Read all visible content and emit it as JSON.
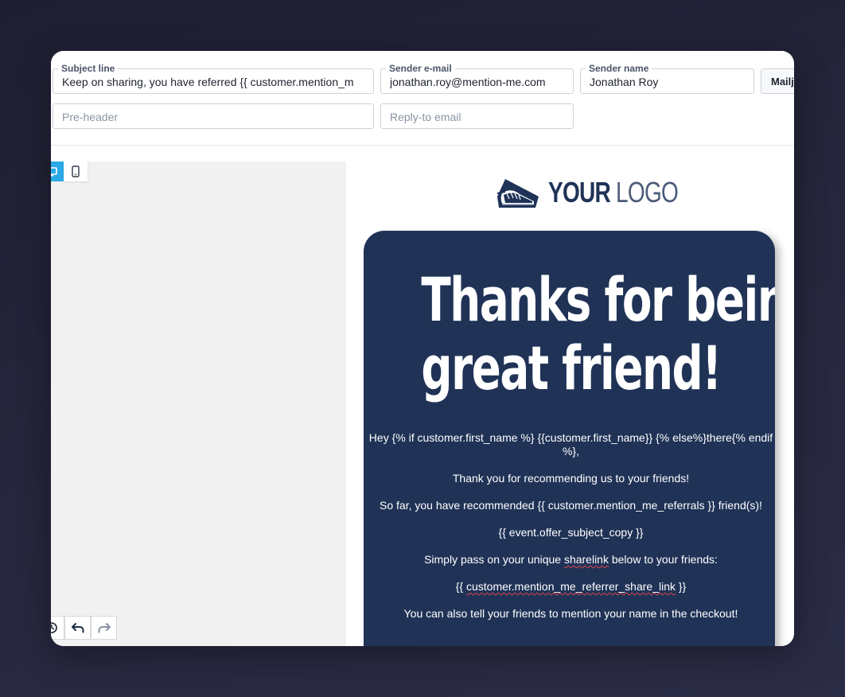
{
  "header": {
    "subject": {
      "label": "Subject line",
      "value": "Keep on sharing, you have referred {{ customer.mention_m"
    },
    "sender_email": {
      "label": "Sender e-mail",
      "value": "jonathan.roy@mention-me.com"
    },
    "sender_name": {
      "label": "Sender name",
      "value": "Jonathan Roy"
    },
    "mail_button_label": "Mailj",
    "pre_header": {
      "placeholder": "Pre-header"
    },
    "reply_to": {
      "placeholder": "Reply-to email"
    }
  },
  "editor": {
    "device_desktop_icon": "desktop-icon",
    "device_mobile_icon": "mobile-icon",
    "history_icon": "history-icon",
    "undo_icon": "undo-icon",
    "redo_icon": "redo-icon"
  },
  "email": {
    "logo": {
      "bold": "YOUR",
      "light": "LOGO",
      "icon": "sneaker-icon"
    },
    "headline_line1": "Thanks for being a",
    "headline_line2": "great friend!",
    "greeting": "Hey {% if customer.first_name %} {{customer.first_name}} {% else%}there{% endif %},",
    "thanks": "Thank you for recommending us to your friends!",
    "so_far": "So far, you have recommended {{ customer.mention_me_referrals }} friend(s)!",
    "offer": "{{ event.offer_subject_copy }}",
    "pass_on_before": "Simply pass on your unique ",
    "pass_on_word": "sharelink",
    "pass_on_after": " below to your friends:",
    "share_before": "{{ ",
    "share_link": "customer.mention_me_referrer_share_link",
    "share_after": " }}",
    "checkout": "You can also tell your friends to mention your name in the checkout!"
  },
  "colors": {
    "email_background": "#203357",
    "accent_blue": "#2aa9e6",
    "page_background": "#23233a"
  }
}
